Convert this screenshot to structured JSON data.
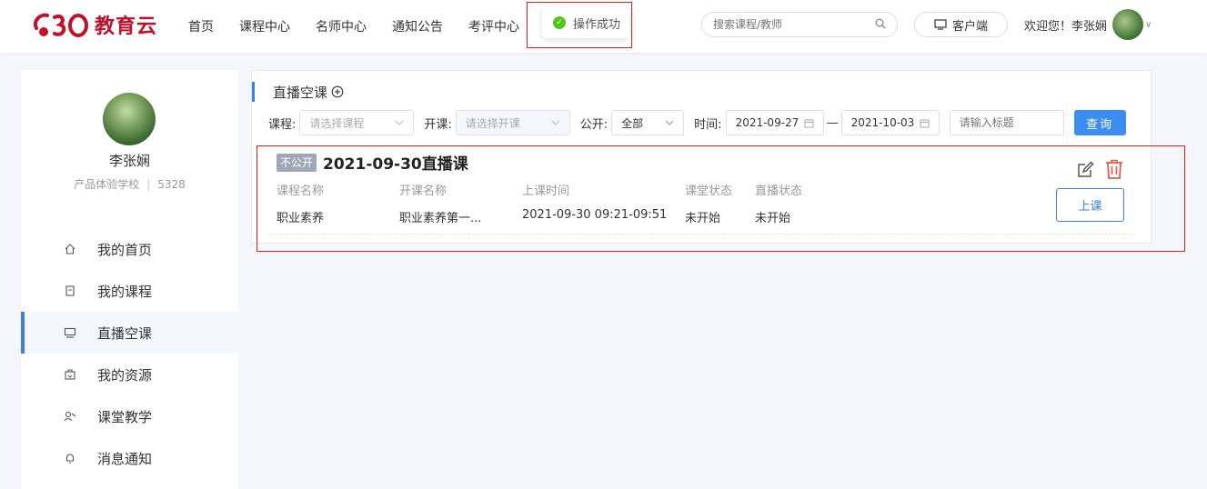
{
  "header": {
    "logo_text": "教育云",
    "nav": [
      "首页",
      "课程中心",
      "名师中心",
      "通知公告",
      "考评中心"
    ],
    "toast": "操作成功",
    "search_placeholder": "搜索课程/教师",
    "client_label": "客户端",
    "welcome": "欢迎您！李张娴"
  },
  "sidebar": {
    "user_name": "李张娴",
    "school": "产品体验学校",
    "user_id": "5328",
    "menu": [
      {
        "label": "我的首页",
        "icon": "home-icon"
      },
      {
        "label": "我的课程",
        "icon": "document-icon"
      },
      {
        "label": "直播空课",
        "icon": "monitor-icon",
        "active": true
      },
      {
        "label": "我的资源",
        "icon": "box-icon"
      },
      {
        "label": "课堂教学",
        "icon": "teacher-icon"
      },
      {
        "label": "消息通知",
        "icon": "bell-icon"
      }
    ]
  },
  "main": {
    "title": "直播空课",
    "filters": {
      "course_label": "课程:",
      "course_placeholder": "请选择课程",
      "open_label": "开课:",
      "open_placeholder": "请选择开课",
      "public_label": "公开:",
      "public_value": "全部",
      "time_label": "时间:",
      "date_start": "2021-09-27",
      "date_sep": "—",
      "date_end": "2021-10-03",
      "title_placeholder": "请输入标题",
      "query_label": "查询"
    },
    "card": {
      "badge": "不公开",
      "title": "2021-09-30直播课",
      "headers": [
        "课程名称",
        "开课名称",
        "上课时间",
        "课堂状态",
        "直播状态"
      ],
      "values": [
        "职业素养",
        "职业素养第一...",
        "2021-09-30 09:21-09:51",
        "未开始",
        "未开始"
      ],
      "start_label": "上课"
    }
  },
  "colors": {
    "accent": "#3c7ef0",
    "success": "#52c41a",
    "danger": "#e05a4a",
    "brand": "#c0102a"
  }
}
